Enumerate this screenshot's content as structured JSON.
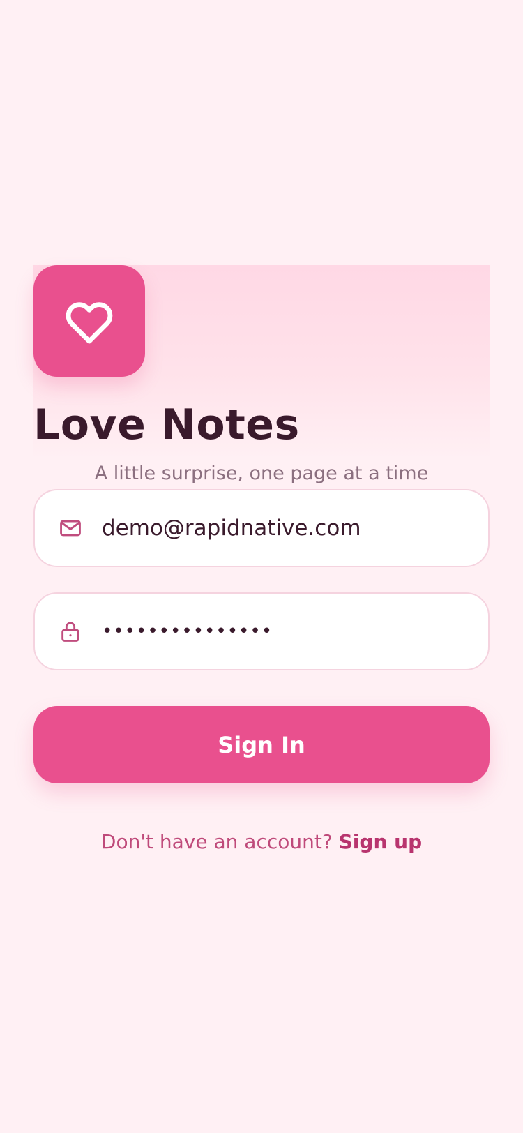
{
  "app": {
    "title": "Love Notes",
    "tagline": "A little surprise, one page at a time",
    "logo_icon": "heart-icon"
  },
  "form": {
    "email": {
      "icon": "mail-icon",
      "value": "demo@rapidnative.com"
    },
    "password": {
      "icon": "lock-icon",
      "value": "•••••••••••••••"
    },
    "submit_label": "Sign In"
  },
  "footer": {
    "prompt": "Don't have an account?",
    "link_label": "Sign up"
  },
  "colors": {
    "background": "#fff0f4",
    "accent": "#e9508e",
    "title_text": "#3a1a2c",
    "muted_text": "#8b6f7f",
    "link_text": "#b8346e"
  }
}
